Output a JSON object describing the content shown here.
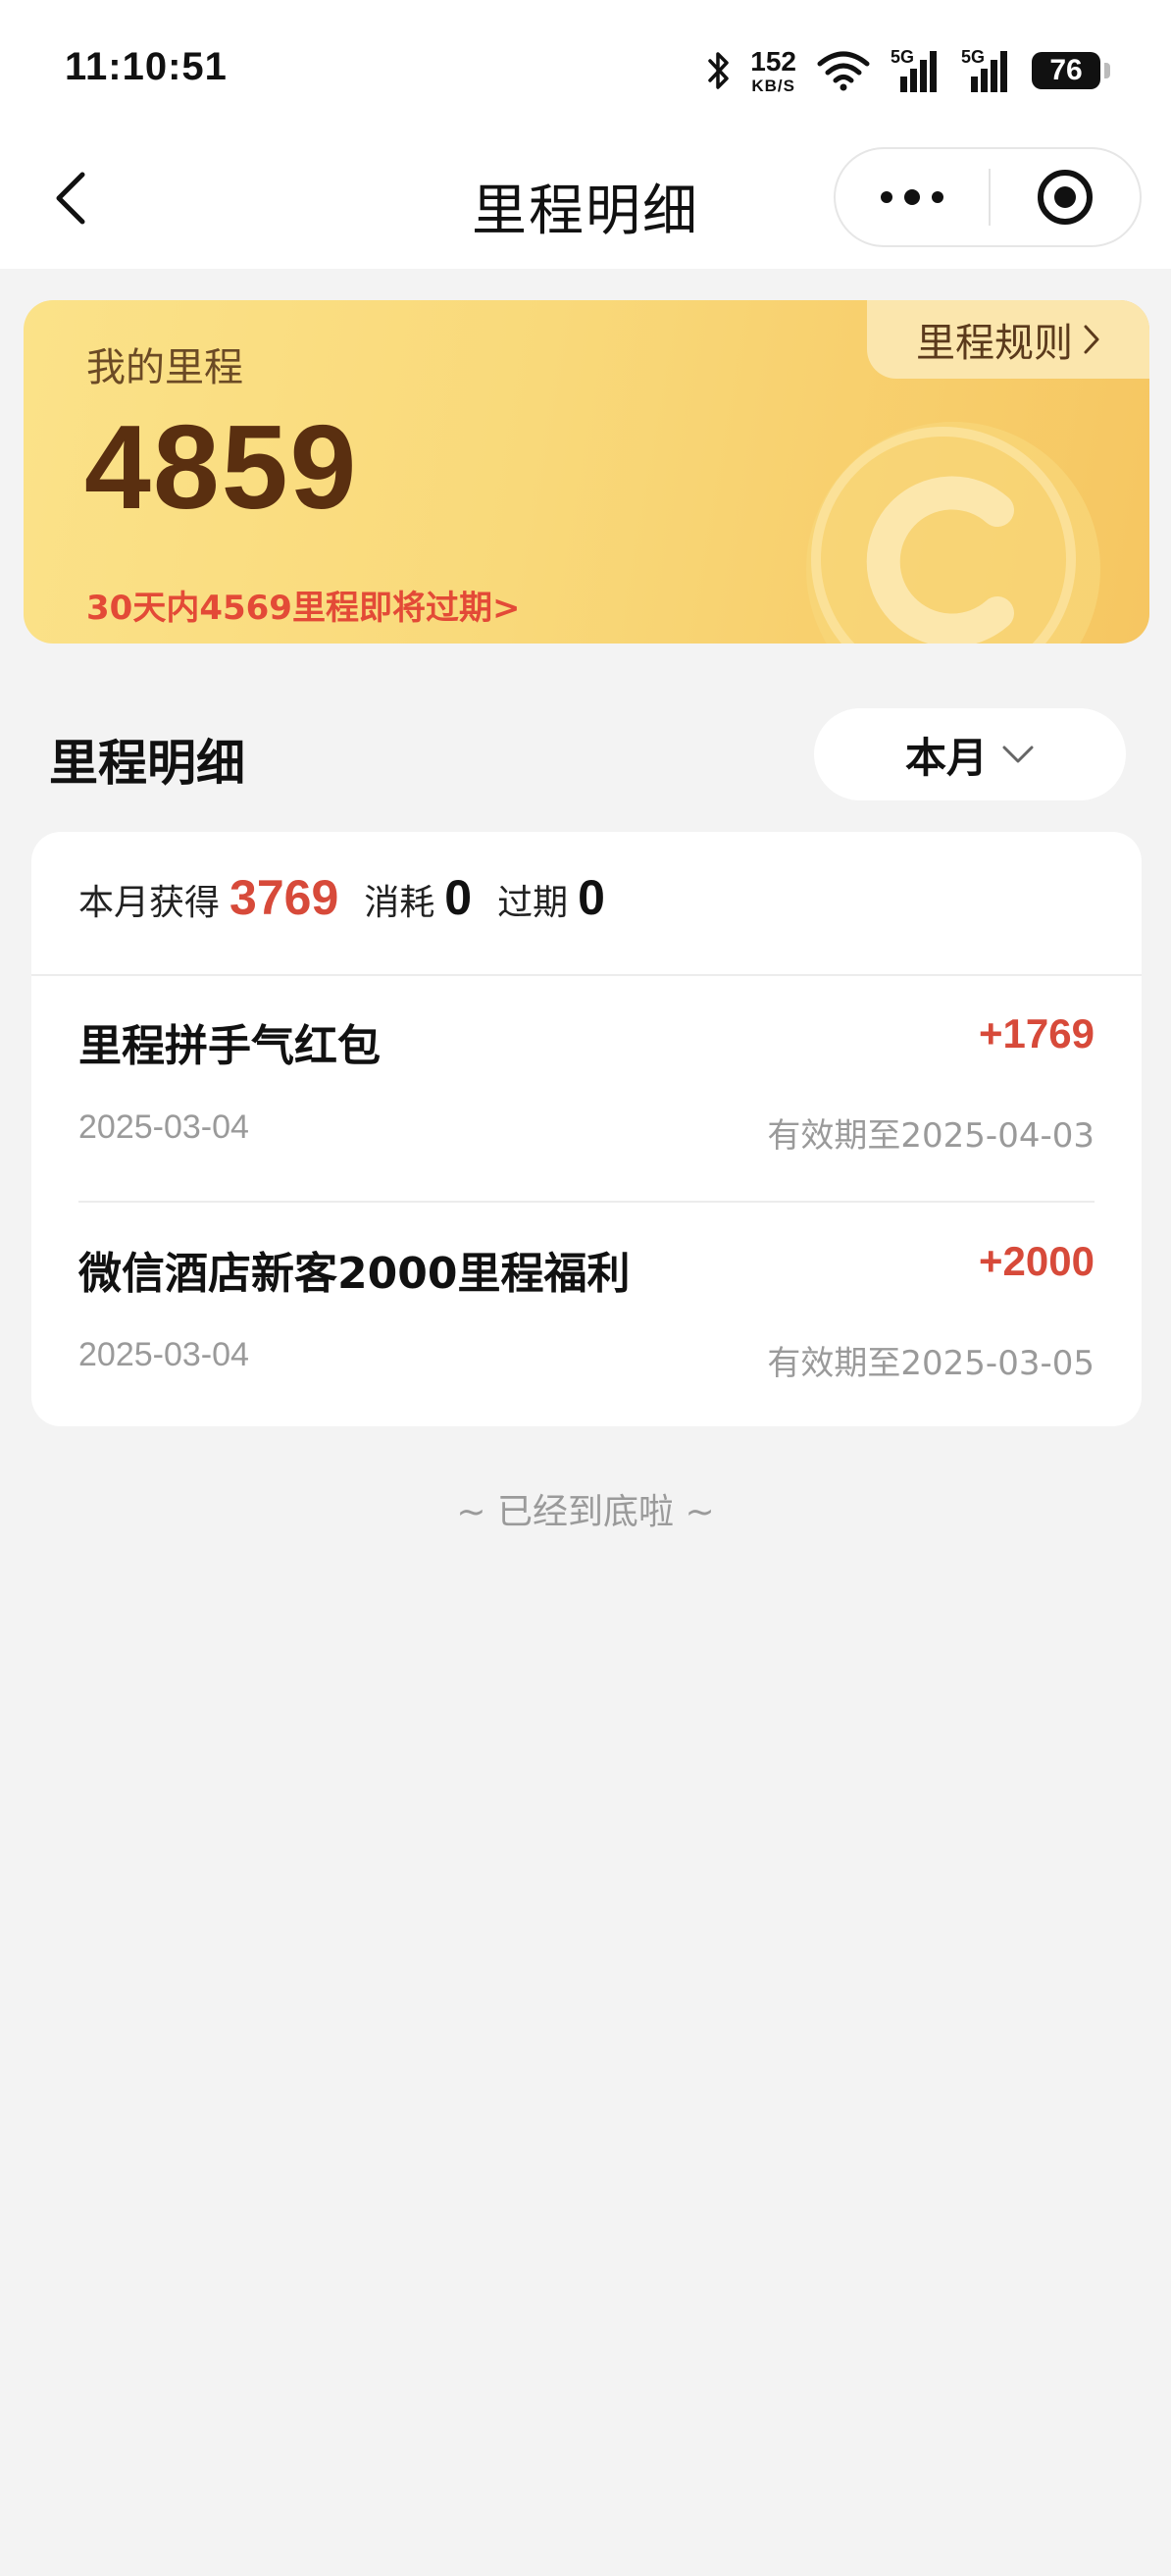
{
  "status_bar": {
    "time": "11:10:51",
    "net_speed": "152",
    "net_unit": "KB/S",
    "signal_1": "5G",
    "signal_2": "5G",
    "battery": "76"
  },
  "nav": {
    "title": "里程明细"
  },
  "mileage_card": {
    "label": "我的里程",
    "points": "4859",
    "expire_notice": "30天内4569里程即将过期>",
    "rules_label": "里程规则"
  },
  "section": {
    "title": "里程明细",
    "period": "本月"
  },
  "summary": {
    "earned_label": "本月获得",
    "earned_value": "3769",
    "spent_label": "消耗",
    "spent_value": "0",
    "expired_label": "过期",
    "expired_value": "0"
  },
  "records": [
    {
      "title": "里程拼手气红包",
      "amount": "+1769",
      "date": "2025-03-04",
      "expire": "有效期至2025-04-03"
    },
    {
      "title": "微信酒店新客2000里程福利",
      "amount": "+2000",
      "date": "2025-03-04",
      "expire": "有效期至2025-03-05"
    }
  ],
  "footer": {
    "end_note": "~ 已经到底啦 ~"
  },
  "colors": {
    "accent_red": "#d74a3a",
    "card_gold": "#f9d97a",
    "points_brown": "#5a2f10"
  }
}
